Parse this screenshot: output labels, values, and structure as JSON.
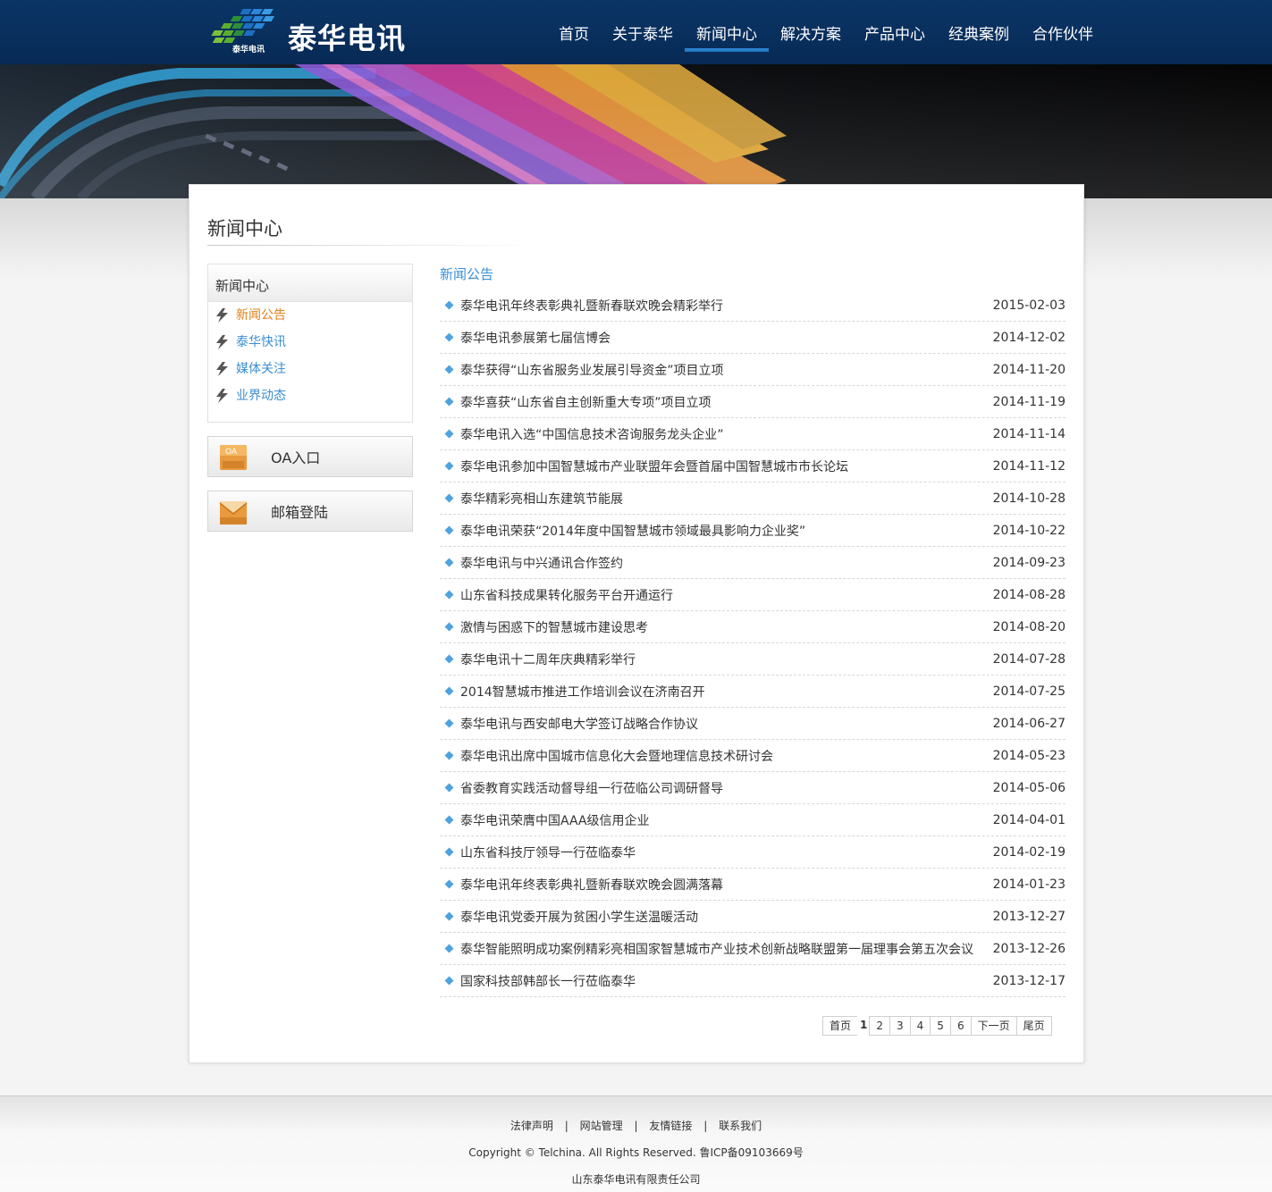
{
  "header": {
    "logo_text": "泰华电讯",
    "logo_sub": "泰华电讯",
    "nav": [
      "首页",
      "关于泰华",
      "新闻中心",
      "解决方案",
      "产品中心",
      "经典案例",
      "合作伙伴"
    ],
    "active_nav": "新闻中心"
  },
  "page": {
    "title": "新闻中心"
  },
  "sidebar": {
    "heading": "新闻中心",
    "items": [
      {
        "label": "新闻公告",
        "active": true
      },
      {
        "label": "泰华快讯",
        "active": false
      },
      {
        "label": "媒体关注",
        "active": false
      },
      {
        "label": "业界动态",
        "active": false
      }
    ],
    "oa_label": "OA入口",
    "oa_icon_text": "OA",
    "mail_label": "邮箱登陆"
  },
  "news": {
    "heading": "新闻公告",
    "items": [
      {
        "title": "泰华电讯年终表彰典礼暨新春联欢晚会精彩举行",
        "date": "2015-02-03"
      },
      {
        "title": "泰华电讯参展第七届信博会",
        "date": "2014-12-02"
      },
      {
        "title": "泰华获得“山东省服务业发展引导资金”项目立项",
        "date": "2014-11-20"
      },
      {
        "title": "泰华喜获“山东省自主创新重大专项”项目立项",
        "date": "2014-11-19"
      },
      {
        "title": "泰华电讯入选“中国信息技术咨询服务龙头企业”",
        "date": "2014-11-14"
      },
      {
        "title": "泰华电讯参加中国智慧城市产业联盟年会暨首届中国智慧城市市长论坛",
        "date": "2014-11-12"
      },
      {
        "title": "泰华精彩亮相山东建筑节能展",
        "date": "2014-10-28"
      },
      {
        "title": "泰华电讯荣获“2014年度中国智慧城市领域最具影响力企业奖”",
        "date": "2014-10-22"
      },
      {
        "title": "泰华电讯与中兴通讯合作签约",
        "date": "2014-09-23"
      },
      {
        "title": "山东省科技成果转化服务平台开通运行",
        "date": "2014-08-28"
      },
      {
        "title": "激情与困惑下的智慧城市建设思考",
        "date": "2014-08-20"
      },
      {
        "title": "泰华电讯十二周年庆典精彩举行",
        "date": "2014-07-28"
      },
      {
        "title": "2014智慧城市推进工作培训会议在济南召开",
        "date": "2014-07-25"
      },
      {
        "title": "泰华电讯与西安邮电大学签订战略合作协议",
        "date": "2014-06-27"
      },
      {
        "title": "泰华电讯出席中国城市信息化大会暨地理信息技术研讨会",
        "date": "2014-05-23"
      },
      {
        "title": "省委教育实践活动督导组一行莅临公司调研督导",
        "date": "2014-05-06"
      },
      {
        "title": "泰华电讯荣膺中国AAA级信用企业",
        "date": "2014-04-01"
      },
      {
        "title": "山东省科技厅领导一行莅临泰华",
        "date": "2014-02-19"
      },
      {
        "title": "泰华电讯年终表彰典礼暨新春联欢晚会圆满落幕",
        "date": "2014-01-23"
      },
      {
        "title": "泰华电讯党委开展为贫困小学生送温暖活动",
        "date": "2013-12-27"
      },
      {
        "title": "泰华智能照明成功案例精彩亮相国家智慧城市产业技术创新战略联盟第一届理事会第五次会议",
        "date": "2013-12-26"
      },
      {
        "title": "国家科技部韩部长一行莅临泰华",
        "date": "2013-12-17"
      }
    ]
  },
  "pagination": {
    "first": "首页",
    "current": "1",
    "pages": [
      "2",
      "3",
      "4",
      "5",
      "6"
    ],
    "next": "下一页",
    "last": "尾页"
  },
  "footer": {
    "links": [
      "法律声明",
      "网站管理",
      "友情链接",
      "联系我们"
    ],
    "separator": "|",
    "copyright": "Copyright © Telchina. All Rights Reserved. 鲁ICP备09103669号",
    "company": "山东泰华电讯有限责任公司"
  },
  "colors": {
    "header_bg": "#0b3566",
    "link_blue": "#3c8ed0",
    "active_orange": "#e0801a",
    "nav_underline": "#2f8bd6"
  }
}
